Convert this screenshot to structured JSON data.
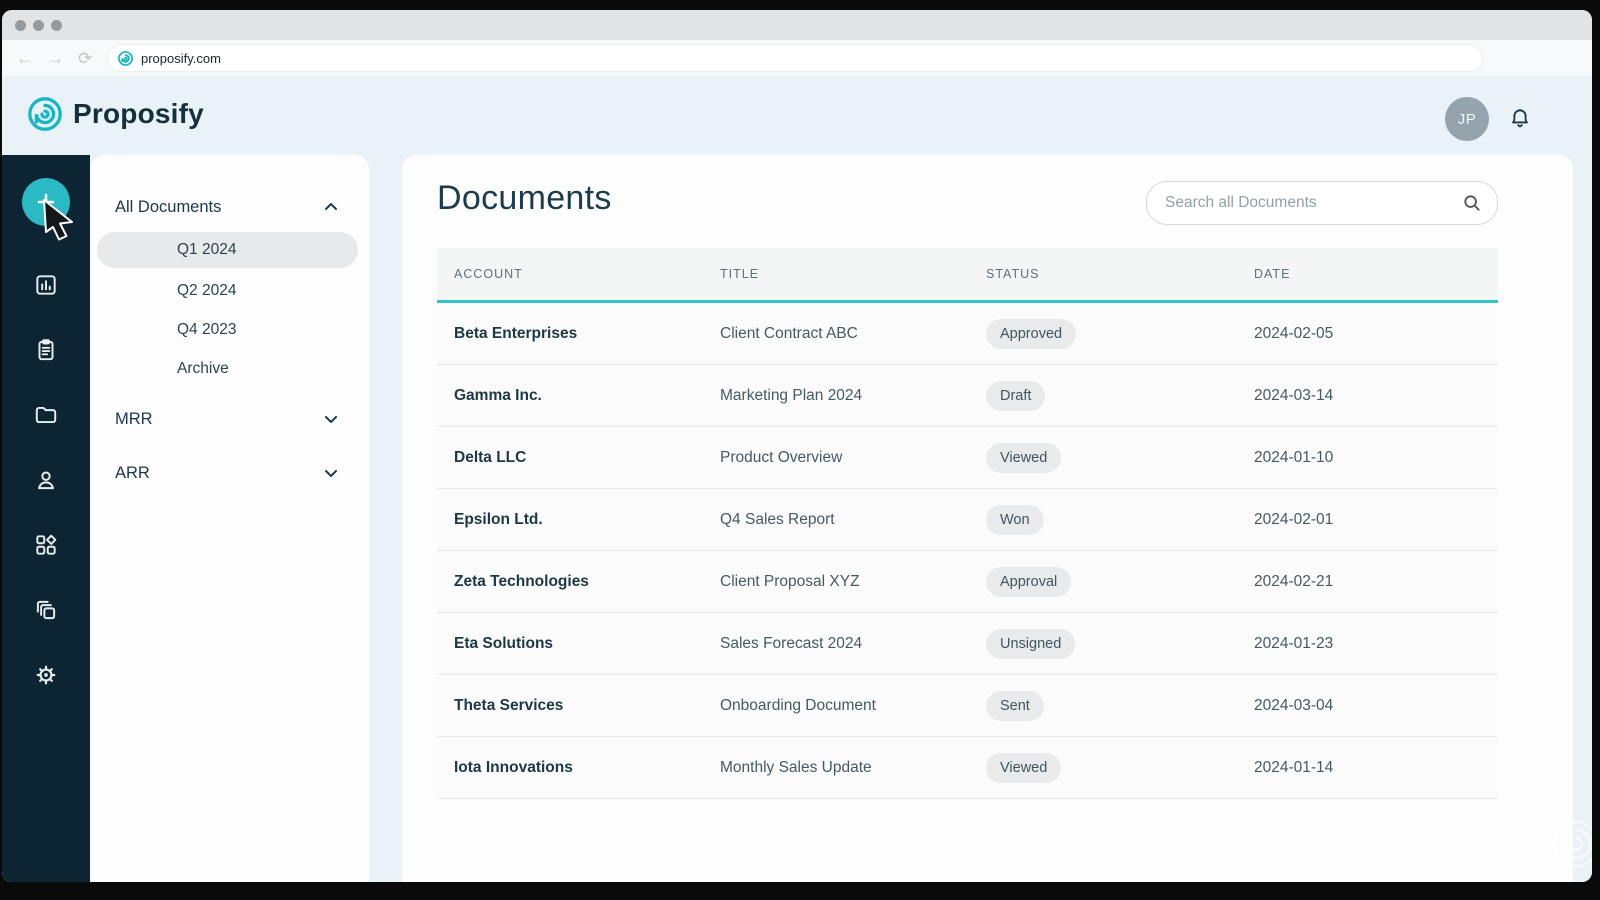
{
  "browser": {
    "url": "proposify.com"
  },
  "header": {
    "brand": "Proposify",
    "avatar_initials": "JP"
  },
  "nav_rail": {
    "items": [
      "plus-icon",
      "bar-chart-icon",
      "clipboard-icon",
      "folder-icon",
      "person-icon",
      "dashboard-icon",
      "copies-icon",
      "settings-icon"
    ]
  },
  "sidebar": {
    "sections": [
      {
        "label": "All Documents",
        "state": "expanded",
        "children": [
          {
            "label": "Q1 2024",
            "selected": true
          },
          {
            "label": "Q2 2024",
            "selected": false
          },
          {
            "label": "Q4 2023",
            "selected": false
          },
          {
            "label": "Archive",
            "selected": false
          }
        ]
      },
      {
        "label": "MRR",
        "state": "collapsed"
      },
      {
        "label": "ARR",
        "state": "collapsed"
      }
    ]
  },
  "main": {
    "title": "Documents",
    "search_placeholder": "Search all Documents",
    "table": {
      "columns": [
        "ACCOUNT",
        "TITLE",
        "STATUS",
        "DATE"
      ],
      "rows": [
        {
          "account": "Beta Enterprises",
          "title": "Client Contract ABC",
          "status": "Approved",
          "date": "2024-02-05"
        },
        {
          "account": "Gamma Inc.",
          "title": "Marketing Plan 2024",
          "status": "Draft",
          "date": "2024-03-14"
        },
        {
          "account": "Delta LLC",
          "title": "Product Overview",
          "status": "Viewed",
          "date": "2024-01-10"
        },
        {
          "account": "Epsilon Ltd.",
          "title": "Q4 Sales Report",
          "status": "Won",
          "date": "2024-02-01"
        },
        {
          "account": "Zeta Technologies",
          "title": "Client Proposal XYZ",
          "status": "Approval",
          "date": "2024-02-21"
        },
        {
          "account": "Eta Solutions",
          "title": "Sales Forecast 2024",
          "status": "Unsigned",
          "date": "2024-01-23"
        },
        {
          "account": "Theta Services",
          "title": "Onboarding Document",
          "status": "Sent",
          "date": "2024-03-04"
        },
        {
          "account": "Iota Innovations",
          "title": "Monthly Sales Update",
          "status": "Viewed",
          "date": "2024-01-14"
        }
      ]
    }
  },
  "colors": {
    "accent_teal": "#29bac5",
    "table_accent_line": "#2fc4c7",
    "nav_rail_bg": "#0d2433",
    "header_bg": "#e8f2f7",
    "badge_bg": "#e8eaeb",
    "brand_navy": "#14303c"
  }
}
